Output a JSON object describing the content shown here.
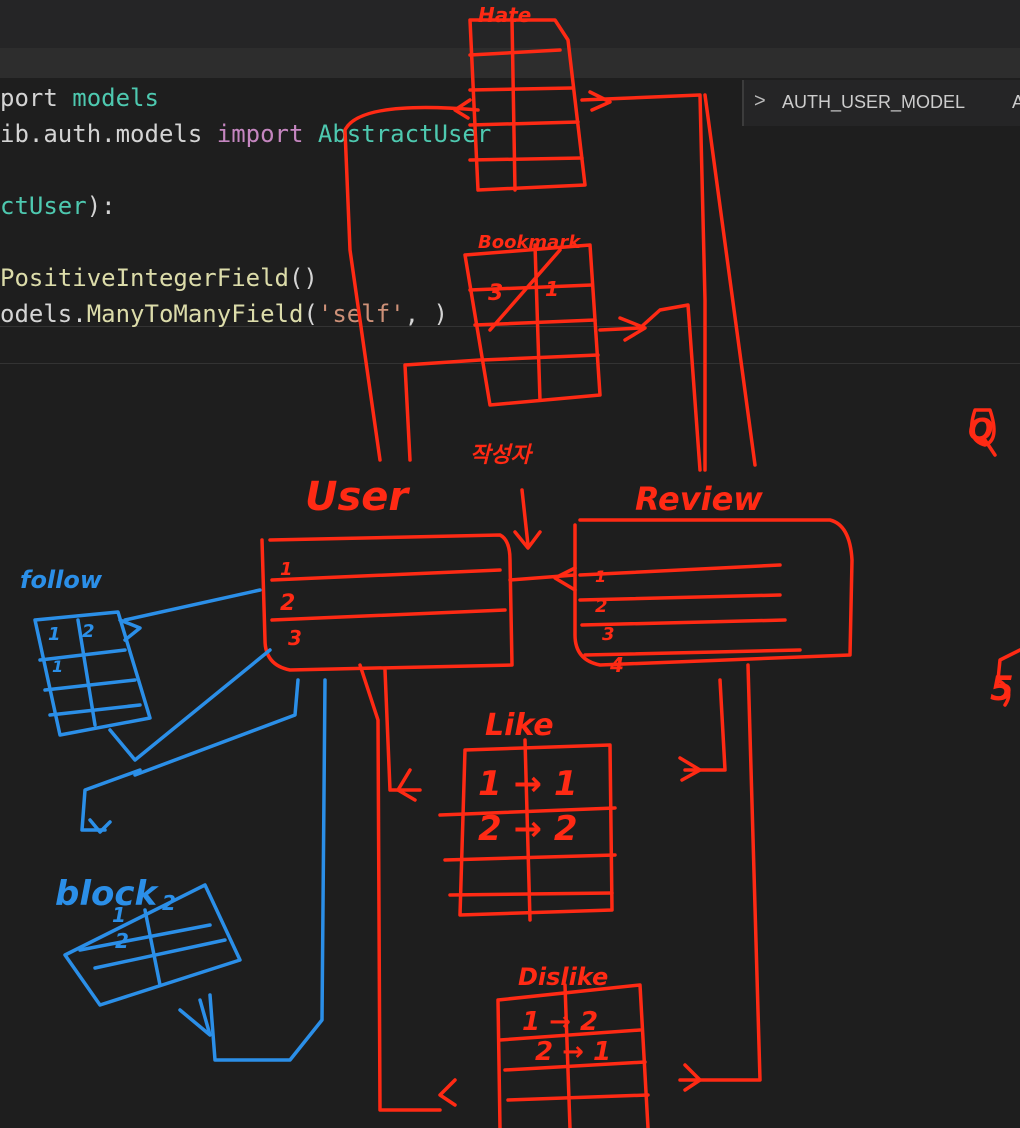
{
  "editor": {
    "lines": [
      {
        "parts": [
          [
            "plain",
            "port "
          ],
          [
            "mod",
            "models"
          ]
        ]
      },
      {
        "parts": [
          [
            "plain",
            "ib.auth.models "
          ],
          [
            "kw",
            "import "
          ],
          [
            "mod",
            "AbstractUser"
          ]
        ]
      },
      {
        "parts": [
          [
            "plain",
            ""
          ]
        ]
      },
      {
        "parts": [
          [
            "mod",
            "ctUser"
          ],
          [
            "plain",
            "):"
          ]
        ]
      },
      {
        "parts": [
          [
            "plain",
            ""
          ]
        ]
      },
      {
        "parts": [
          [
            "fn",
            "PositiveIntegerField"
          ],
          [
            "plain",
            "()"
          ]
        ]
      },
      {
        "parts": [
          [
            "plain",
            "odels."
          ],
          [
            "fn",
            "ManyToManyField"
          ],
          [
            "plain",
            "("
          ],
          [
            "str",
            "'self'"
          ],
          [
            "plain",
            ", )"
          ]
        ]
      }
    ]
  },
  "outline": {
    "chevron": ">",
    "item": "AUTH_USER_MODEL",
    "trailing": "A"
  },
  "drawing": {
    "labels": {
      "hate": "Hate",
      "bookmark": "Bookmark",
      "author": "작성자",
      "user": "User",
      "review": "Review",
      "follow": "follow",
      "like": "Like",
      "block": "block",
      "dislike": "Dislike",
      "q": "Q",
      "five": "5"
    },
    "user_rows": [
      "1",
      "2",
      "3"
    ],
    "review_rows": [
      "1",
      "2",
      "3",
      "4"
    ],
    "follow_cells": [
      "1",
      "2",
      "1"
    ],
    "bookmark_cells": [
      "3",
      "1"
    ],
    "like_rows": [
      "1 → 1",
      "2 → 2"
    ],
    "dislike_rows": [
      "1 → 2",
      "2 → 1"
    ],
    "block_cells": [
      "1",
      "2",
      "2"
    ],
    "colors": {
      "red": "#ff2a14",
      "blue": "#2b8fe8"
    }
  }
}
